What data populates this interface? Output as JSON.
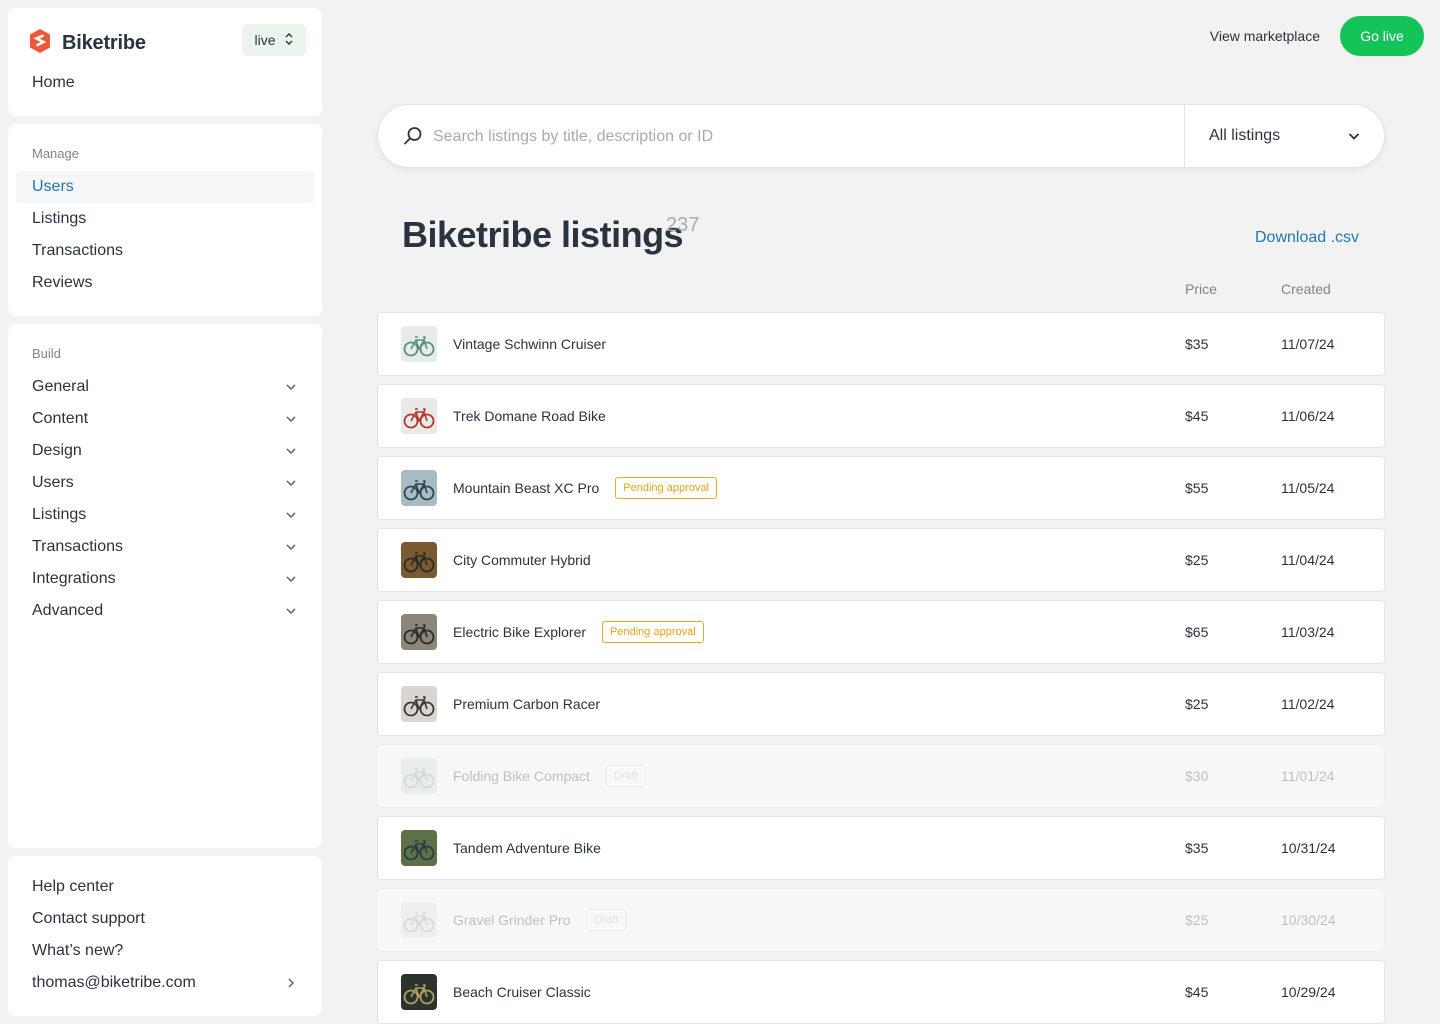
{
  "app": {
    "brand_name": "Biketribe",
    "env_label": "live",
    "brand_color": "#f0573a",
    "accent_color": "#14c458",
    "link_color": "#1f78b4"
  },
  "sidebar": {
    "home": "Home",
    "manage_label": "Manage",
    "manage_items": [
      "Users",
      "Listings",
      "Transactions",
      "Reviews"
    ],
    "active_item": "Users",
    "build_label": "Build",
    "build_items": [
      "General",
      "Content",
      "Design",
      "Users",
      "Listings",
      "Transactions",
      "Integrations",
      "Advanced"
    ],
    "bottom_items": [
      "Help center",
      "Contact support",
      "What’s new?"
    ],
    "account_email": "thomas@biketribe.com"
  },
  "topbar": {
    "view_marketplace": "View marketplace",
    "go_live": "Go live"
  },
  "search": {
    "placeholder": "Search listings by title, description or ID",
    "value": "",
    "filter_selected": "All listings"
  },
  "listings": {
    "title": "Biketribe listings",
    "count": "237",
    "download_label": "Download .csv",
    "col_price": "Price",
    "col_created": "Created",
    "rows": [
      {
        "title": "Vintage Schwinn Cruiser",
        "badge": "",
        "price": "$35",
        "created": "11/07/24",
        "status": "published",
        "thumb_bg": "#e8ece9",
        "thumb_fg": "#5a8f7f"
      },
      {
        "title": "Trek Domane Road Bike",
        "badge": "",
        "price": "$45",
        "created": "11/06/24",
        "status": "published",
        "thumb_bg": "#e9e9e9",
        "thumb_fg": "#b4372c"
      },
      {
        "title": "Mountain Beast XC Pro",
        "badge": "Pending approval",
        "price": "$55",
        "created": "11/05/24",
        "status": "pending",
        "thumb_bg": "#a9bcc5",
        "thumb_fg": "#2d4550"
      },
      {
        "title": "City Commuter Hybrid",
        "badge": "",
        "price": "$25",
        "created": "11/04/24",
        "status": "published",
        "thumb_bg": "#7a5a30",
        "thumb_fg": "#2b2b2b"
      },
      {
        "title": "Electric Bike Explorer",
        "badge": "Pending approval",
        "price": "$65",
        "created": "11/03/24",
        "status": "pending",
        "thumb_bg": "#8b8678",
        "thumb_fg": "#2b2b2b"
      },
      {
        "title": "Premium Carbon Racer",
        "badge": "",
        "price": "$25",
        "created": "11/02/24",
        "status": "published",
        "thumb_bg": "#d9d6cf",
        "thumb_fg": "#3a3a3a"
      },
      {
        "title": "Folding Bike Compact",
        "badge": "Draft",
        "price": "$30",
        "created": "11/01/24",
        "status": "draft",
        "thumb_bg": "#c9d9c9",
        "thumb_fg": "#7a8f7a"
      },
      {
        "title": "Tandem Adventure Bike",
        "badge": "",
        "price": "$35",
        "created": "10/31/24",
        "status": "published",
        "thumb_bg": "#5e7048",
        "thumb_fg": "#2b3a45"
      },
      {
        "title": "Gravel Grinder Pro",
        "badge": "Draft",
        "price": "$25",
        "created": "10/30/24",
        "status": "draft",
        "thumb_bg": "#dedede",
        "thumb_fg": "#8a8a8a"
      },
      {
        "title": "Beach Cruiser Classic",
        "badge": "",
        "price": "$45",
        "created": "10/29/24",
        "status": "published",
        "thumb_bg": "#2a332c",
        "thumb_fg": "#b0a060"
      }
    ]
  },
  "icons": {
    "brand_logo": "biketribe-logo-icon",
    "env_chevron": "chevron-up-down-icon",
    "nav_chevron": "chevron-down-icon",
    "account_chevron": "chevron-right-icon",
    "search": "search-icon",
    "filter_chevron": "chevron-down-icon",
    "thumb": "bicycle-icon"
  }
}
